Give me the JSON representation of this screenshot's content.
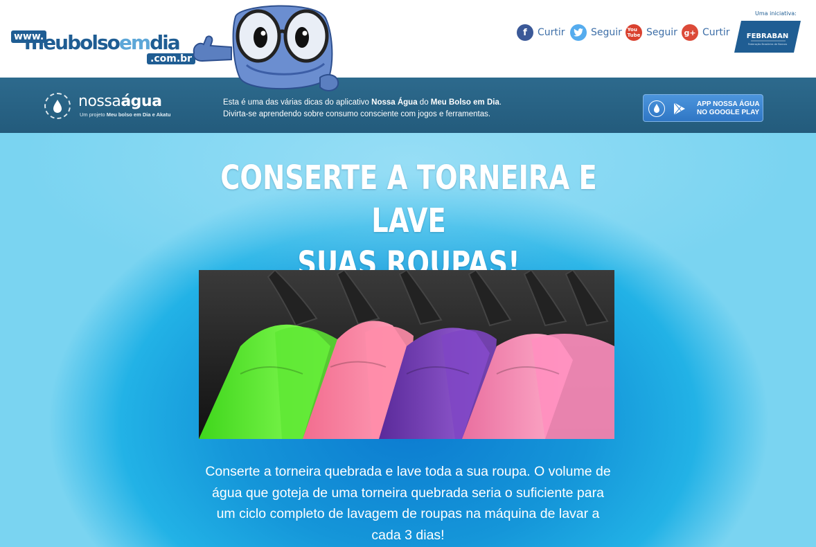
{
  "header": {
    "logo": {
      "www": "www.",
      "part1": "meubolso",
      "part2": "em",
      "part3": "dia",
      "com": ".com.br"
    },
    "social": [
      {
        "icon": "facebook-icon",
        "label": "Curtir",
        "color": "#3b5998"
      },
      {
        "icon": "twitter-icon",
        "label": "Seguir",
        "color": "#55acee"
      },
      {
        "icon": "youtube-icon",
        "label": "Seguir",
        "color": "#d9412f"
      },
      {
        "icon": "google-plus-icon",
        "label": "Curtir",
        "color": "#dc4a38"
      }
    ],
    "initiative_label": "Uma iniciativa:",
    "febraban": {
      "name": "FEBRABAN",
      "tagline": "Federação Brasileira de Bancos"
    }
  },
  "app_band": {
    "logo_light": "nossa",
    "logo_bold": "água",
    "logo_sub_prefix": "Um projeto ",
    "logo_sub_bold": "Meu bolso em Dia e Akatu",
    "text_1": "Esta é uma das várias dicas do aplicativo ",
    "text_bold_1": "Nossa Água",
    "text_2": " do ",
    "text_bold_2": "Meu Bolso em Dia",
    "text_3": ".",
    "text_line2": "Divirta-se aprendendo sobre consumo consciente com jogos e ferramentas.",
    "button_line1": "APP NOSSA ÁGUA",
    "button_line2": "NO GOOGLE PLAY"
  },
  "main": {
    "title_line1": "CONSERTE A TORNEIRA E LAVE",
    "title_line2": "SUAS ROUPAS!",
    "body": "Conserte a torneira quebrada e lave toda a sua roupa. O volume de água que goteja de uma torneira quebrada seria o suficiente para um ciclo completo de lavagem de roupas na máquina de lavar a cada 3 dias!"
  },
  "colors": {
    "brand_blue": "#1f5d93",
    "band": "#2a6588",
    "content_blue": "#1596d9"
  }
}
